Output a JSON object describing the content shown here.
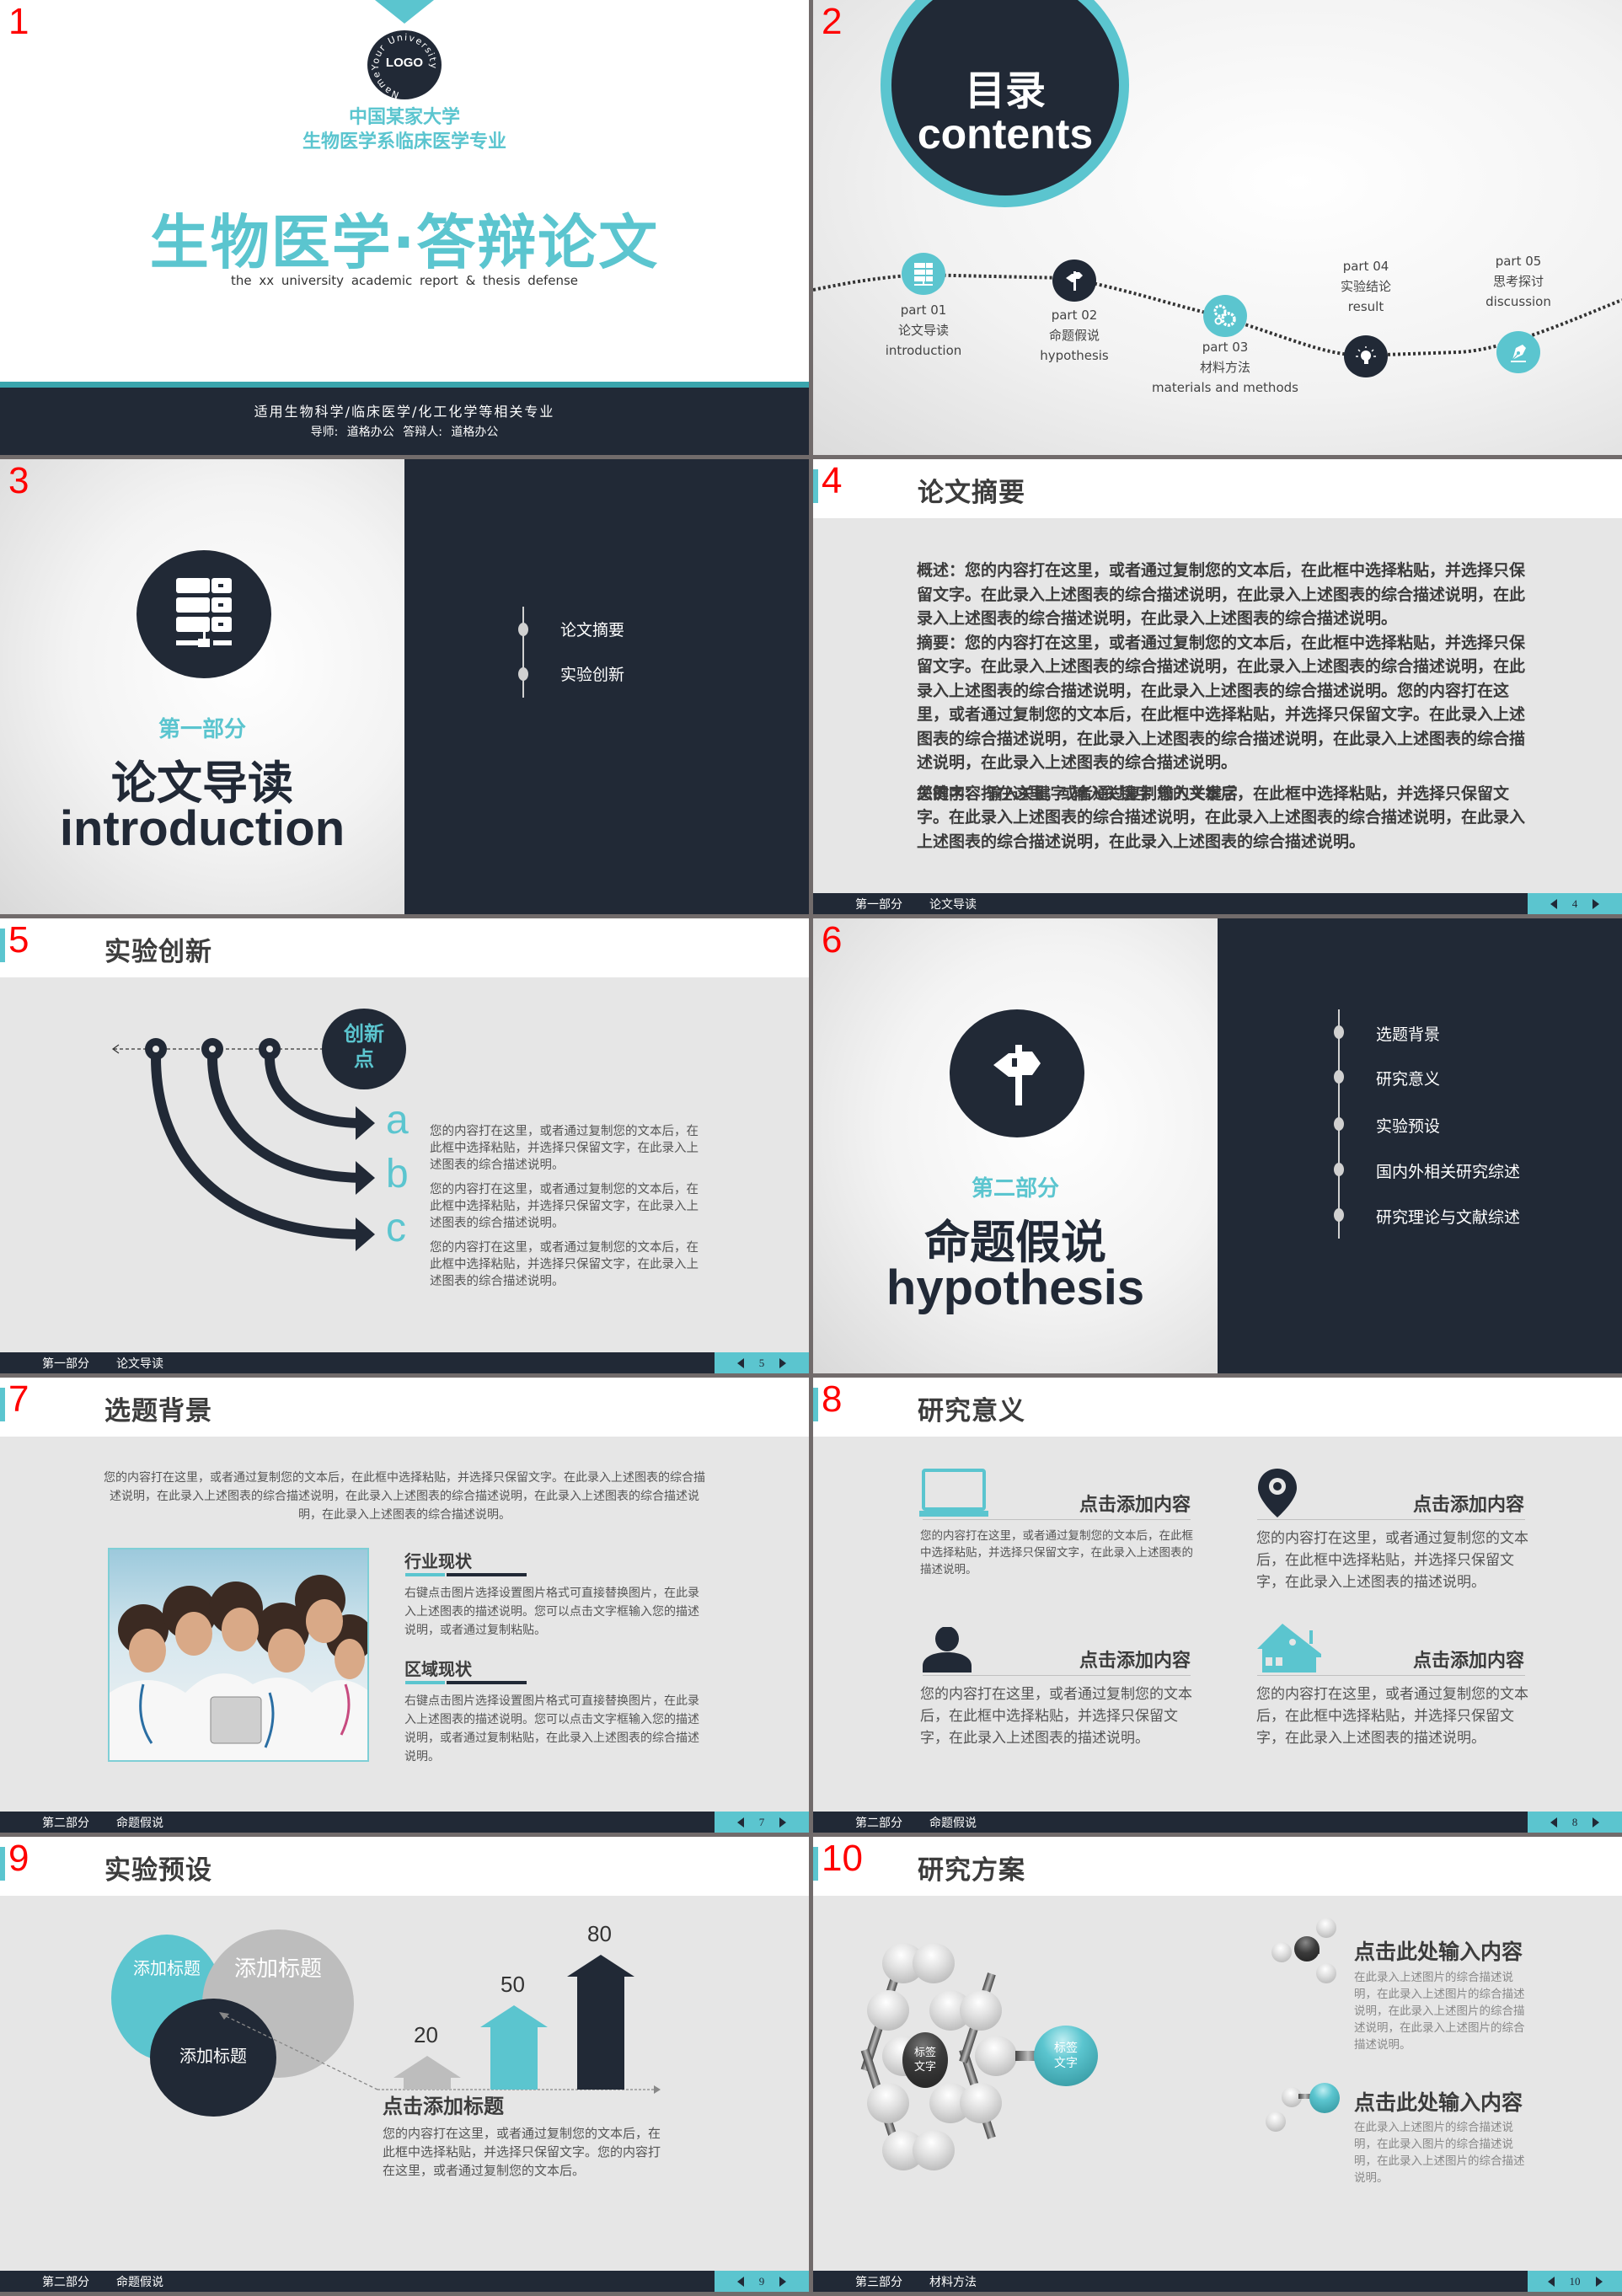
{
  "theme": {
    "teal": "#5bc5cf",
    "navy": "#212936",
    "gray": "#bdbdbd",
    "slide_number_color": "#ff0000"
  },
  "slides": [
    {
      "number": "1",
      "logo_text": "LOGO",
      "logo_ring_text": "NameYour University",
      "university": "中国某家大学",
      "department": "生物医学系临床医学专业",
      "title": "生物医学·答辩论文",
      "subtitle": "the xx university academic report & thesis defense",
      "applicable": "适用生物科学/临床医学/化工化学等相关专业",
      "advisor_line": "导师: 道格办公    答辩人: 道格办公"
    },
    {
      "number": "2",
      "title_cn": "目录",
      "title_en": "contents",
      "parts": [
        {
          "part": "part 01",
          "cn": "论文导读",
          "en": "introduction",
          "icon": "server-icon",
          "color": "teal"
        },
        {
          "part": "part 02",
          "cn": "命题假说",
          "en": "hypothesis",
          "icon": "signpost-icon",
          "color": "navy"
        },
        {
          "part": "part 03",
          "cn": "材料方法",
          "en": "materials and methods",
          "icon": "gears-icon",
          "color": "teal"
        },
        {
          "part": "part 04",
          "cn": "实验结论",
          "en": "result",
          "icon": "lightbulb-icon",
          "color": "navy"
        },
        {
          "part": "part 05",
          "cn": "思考探讨",
          "en": "discussion",
          "icon": "pen-nib-icon",
          "color": "teal"
        }
      ]
    },
    {
      "number": "3",
      "icon": "server-icon",
      "part_label": "第一部分",
      "title_cn": "论文导读",
      "title_en": "introduction",
      "items": [
        "论文摘要",
        "实验创新"
      ]
    },
    {
      "number": "4",
      "title": "论文摘要",
      "paragraphs": [
        "概述：您的内容打在这里，或者通过复制您的文本后，在此框中选择粘贴，并选择只保留文字。在此录入上述图表的综合描述说明，在此录入上述图表的综合描述说明，在此录入上述图表的综合描述说明，在此录入上述图表的综合描述说明。",
        "摘要：您的内容打在这里，或者通过复制您的文本后，在此框中选择粘贴，并选择只保留文字。在此录入上述图表的综合描述说明，在此录入上述图表的综合描述说明，在此录入上述图表的综合描述说明，在此录入上述图表的综合描述说明。您的内容打在这里，或者通过复制您的文本后，在此框中选择粘贴，并选择只保留文字。在此录入上述图表的综合描述说明，在此录入上述图表的综合描述说明，在此录入上述图表的综合描述说明，在此录入上述图表的综合描述说明。"
      ],
      "keywords_line": "关键字：  输入关键字    输入关键字    输入关键字",
      "overlap_paragraph": "您的内容打在这里，或者通过复制您的文本后，在此框中选择粘贴，并选择只保留文字。在此录入上述图表的综合描述说明，在此录入上述图表的综合描述说明，在此录入上述图表的综合描述说明，在此录入上述图表的综合描述说明。",
      "footer": {
        "section": "第一部分",
        "subsection": "论文导读",
        "page": "4"
      }
    },
    {
      "number": "5",
      "title": "实验创新",
      "center_label": "创新点",
      "center_label_l1": "创新",
      "center_label_l2": "点",
      "points": [
        {
          "letter": "a",
          "text": "您的内容打在这里，或者通过复制您的文本后，在此框中选择粘贴，并选择只保留文字，在此录入上述图表的综合描述说明。"
        },
        {
          "letter": "b",
          "text": "您的内容打在这里，或者通过复制您的文本后，在此框中选择粘贴，并选择只保留文字，在此录入上述图表的综合描述说明。"
        },
        {
          "letter": "c",
          "text": "您的内容打在这里，或者通过复制您的文本后，在此框中选择粘贴，并选择只保留文字，在此录入上述图表的综合描述说明。"
        }
      ],
      "footer": {
        "section": "第一部分",
        "subsection": "论文导读",
        "page": "5"
      }
    },
    {
      "number": "6",
      "icon": "signpost-icon",
      "part_label": "第二部分",
      "title_cn": "命题假说",
      "title_en": "hypothesis",
      "items": [
        "选题背景",
        "研究意义",
        "实验预设",
        "国内外相关研究综述",
        "研究理论与文献综述"
      ]
    },
    {
      "number": "7",
      "title": "选题背景",
      "intro": "您的内容打在这里，或者通过复制您的文本后，在此框中选择粘贴，并选择只保留文字。在此录入上述图表的综合描述说明，在此录入上述图表的综合描述说明，在此录入上述图表的综合描述说明，在此录入上述图表的综合描述说明，在此录入上述图表的综合描述说明。",
      "photo_alt": "doctors-group-photo",
      "sections": [
        {
          "heading": "行业现状",
          "text": "右键点击图片选择设置图片格式可直接替换图片，在此录入上述图表的描述说明。您可以点击文字框输入您的描述说明，或者通过复制粘贴。"
        },
        {
          "heading": "区域现状",
          "text": "右键点击图片选择设置图片格式可直接替换图片，在此录入上述图表的描述说明。您可以点击文字框输入您的描述说明，或者通过复制粘贴，在此录入上述图表的综合描述说明。"
        }
      ],
      "footer": {
        "section": "第二部分",
        "subsection": "命题假说",
        "page": "7"
      }
    },
    {
      "number": "8",
      "title": "研究意义",
      "cards": [
        {
          "icon": "laptop-icon",
          "heading": "点击添加内容",
          "text": "您的内容打在这里，或者通过复制您的文本后，在此框中选择粘贴，并选择只保留文字，在此录入上述图表的描述说明。"
        },
        {
          "icon": "map-pin-icon",
          "heading": "点击添加内容",
          "text": "您的内容打在这里，或者通过复制您的文本后，在此框中选择粘贴，并选择只保留文字，在此录入上述图表的描述说明。"
        },
        {
          "icon": "user-icon",
          "heading": "点击添加内容",
          "text": "您的内容打在这里，或者通过复制您的文本后，在此框中选择粘贴，并选择只保留文字，在此录入上述图表的描述说明。"
        },
        {
          "icon": "house-icon",
          "heading": "点击添加内容",
          "text": "您的内容打在这里，或者通过复制您的文本后，在此框中选择粘贴，并选择只保留文字，在此录入上述图表的描述说明。"
        }
      ],
      "footer": {
        "section": "第二部分",
        "subsection": "命题假说",
        "page": "8"
      }
    },
    {
      "number": "9",
      "title": "实验预设",
      "circles": [
        "添加标题",
        "添加标题",
        "添加标题"
      ],
      "arrow_values": [
        20,
        50,
        80
      ],
      "arrow_labels": [
        "20",
        "50",
        "80"
      ],
      "heading": "点击添加标题",
      "text": "您的内容打在这里，或者通过复制您的文本后，在此框中选择粘贴，并选择只保留文字。您的内容打在这里，或者通过复制您的文本后。",
      "footer": {
        "section": "第二部分",
        "subsection": "命题假说",
        "page": "9"
      }
    },
    {
      "number": "10",
      "title": "研究方案",
      "center_tag": "标签文字",
      "center_tag_l1": "标签",
      "center_tag_l2": "文字",
      "side_tag_l1": "标签",
      "side_tag_l2": "文字",
      "blocks": [
        {
          "heading": "点击此处输入内容",
          "text": "在此录入上述图片的综合描述说明，在此录入上述图片的综合描述说明，在此录入上述图片的综合描述说明，在此录入上述图片的综合描述说明。"
        },
        {
          "heading": "点击此处输入内容",
          "text": "在此录入上述图片的综合描述说明，在此录入图片的综合描述说明，在此录入上述图片的综合描述说明。"
        }
      ],
      "footer": {
        "section": "第三部分",
        "subsection": "材料方法",
        "page": "10"
      }
    }
  ]
}
